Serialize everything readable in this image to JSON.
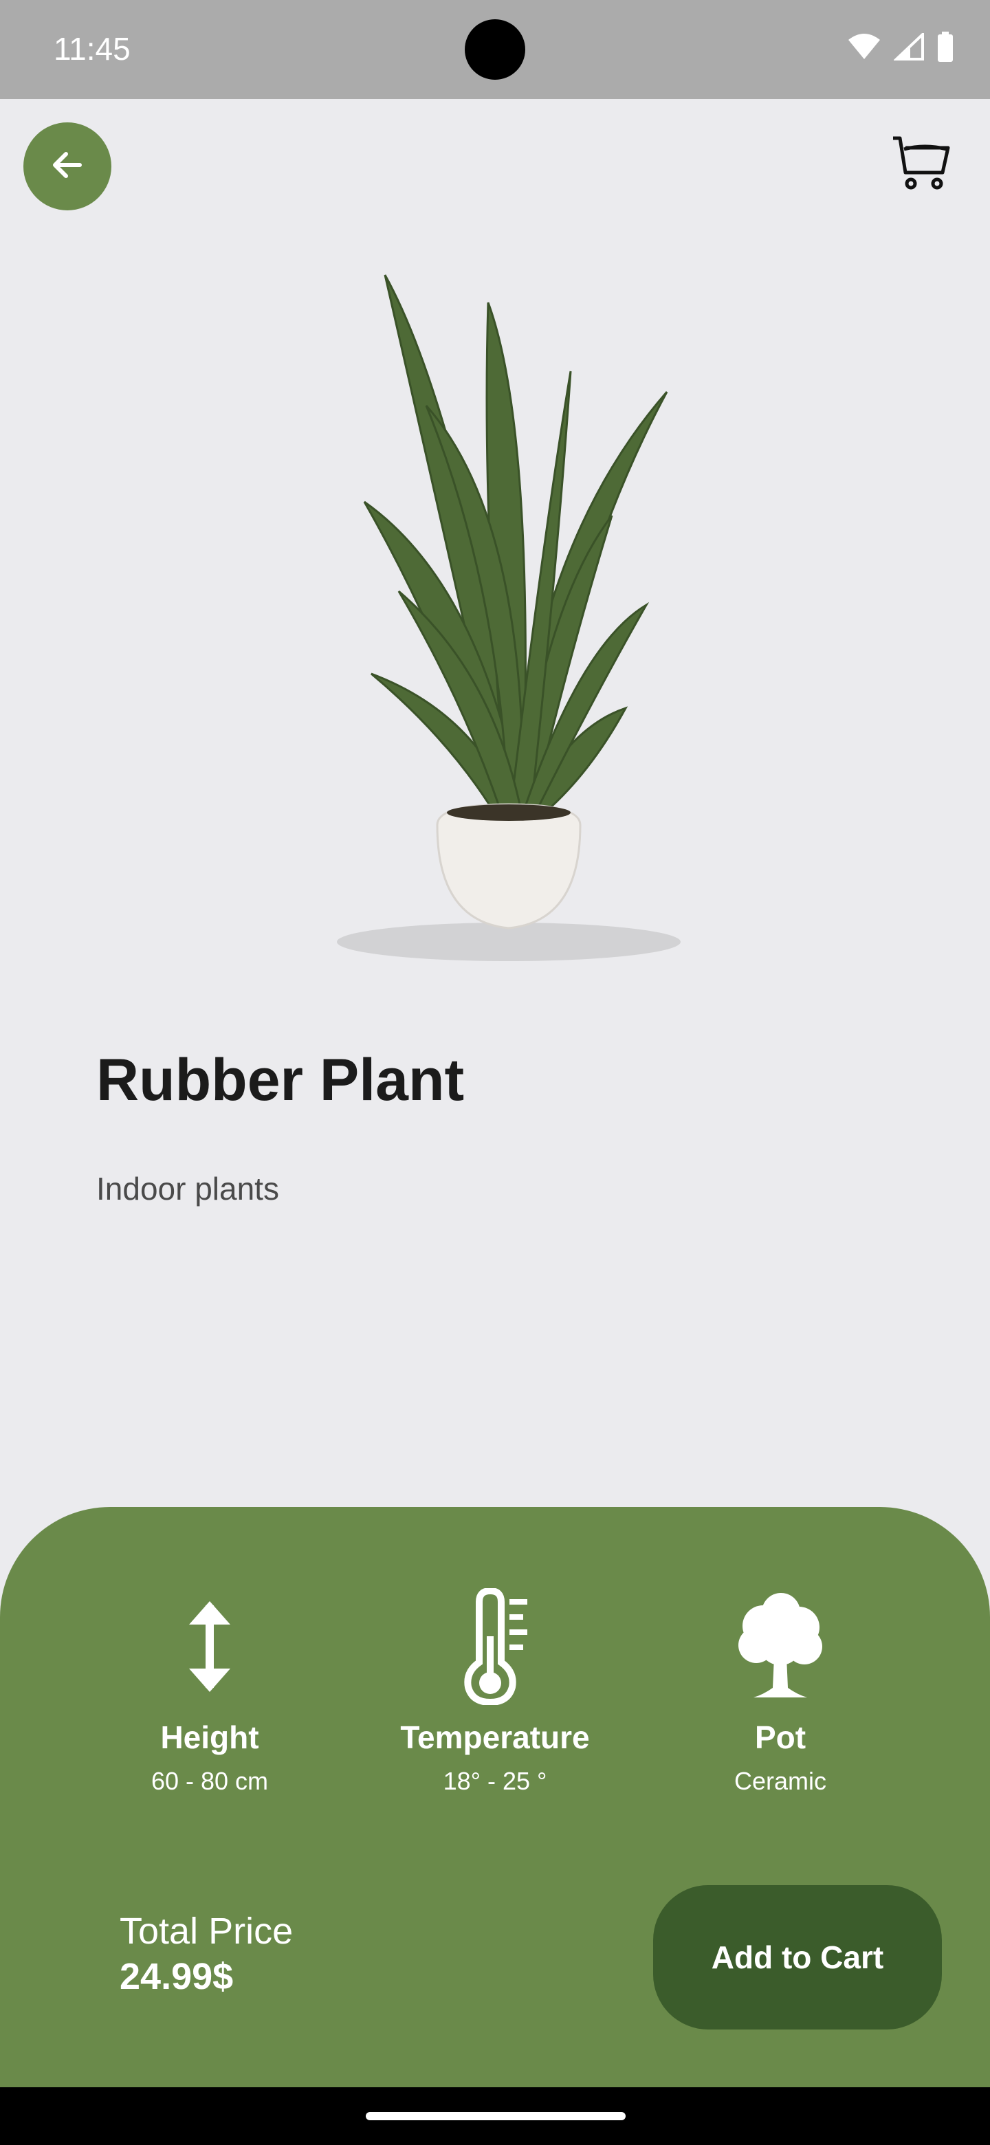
{
  "status_bar": {
    "time": "11:45",
    "icons": [
      "wifi-icon",
      "signal-icon",
      "battery-icon"
    ]
  },
  "header": {
    "back_icon": "arrow-left-icon",
    "cart_icon": "cart-icon"
  },
  "product": {
    "image": "rubber-plant-in-white-pot",
    "title": "Rubber Plant",
    "category": "Indoor plants"
  },
  "specs": [
    {
      "icon": "height-arrows-icon",
      "label": "Height",
      "value": "60 - 80 cm"
    },
    {
      "icon": "thermometer-icon",
      "label": "Temperature",
      "value": "18° - 25 °"
    },
    {
      "icon": "tree-icon",
      "label": "Pot",
      "value": "Ceramic"
    }
  ],
  "footer": {
    "price_label": "Total Price",
    "price_value": "24.99$",
    "add_to_cart_label": "Add to Cart"
  },
  "colors": {
    "accent_green": "#6a8a4a",
    "dark_green": "#3b5c2b",
    "background": "#ebebee",
    "status_bar": "#ababab"
  }
}
